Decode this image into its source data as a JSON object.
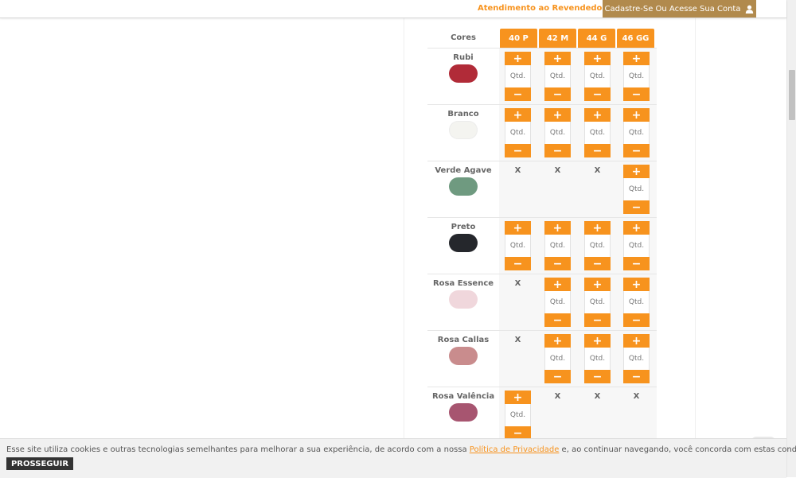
{
  "topbar": {
    "reseller_link": "Atendimento ao Revendedor",
    "account_button": "Cadastre-Se Ou Acesse Sua Conta"
  },
  "grid": {
    "colors_label": "Cores",
    "sizes": [
      "40 P",
      "42 M",
      "44 G",
      "46 GG"
    ],
    "plus_symbol": "+",
    "minus_symbol": "−",
    "qty_placeholder": "Qtd.",
    "unavailable_mark": "X",
    "rows": [
      {
        "name": "Rubi",
        "swatch": "#b12b38",
        "available": [
          true,
          true,
          true,
          true
        ]
      },
      {
        "name": "Branco",
        "swatch": "#f4f4f0",
        "available": [
          true,
          true,
          true,
          true
        ]
      },
      {
        "name": "Verde Agave",
        "swatch": "#6f9a80",
        "available": [
          false,
          false,
          false,
          true
        ]
      },
      {
        "name": "Preto",
        "swatch": "#25272c",
        "available": [
          true,
          true,
          true,
          true
        ]
      },
      {
        "name": "Rosa Essence",
        "swatch": "#f0d7dc",
        "available": [
          false,
          true,
          true,
          true
        ]
      },
      {
        "name": "Rosa Callas",
        "swatch": "#c98c8d",
        "available": [
          false,
          true,
          true,
          true
        ]
      },
      {
        "name": "Rosa Valência",
        "swatch": "#a75570",
        "available": [
          true,
          false,
          false,
          false
        ]
      }
    ]
  },
  "cookie": {
    "text_before": "Esse site utiliza cookies e outras tecnologias semelhantes para melhorar a sua experiência, de acordo com a nossa ",
    "link": "Política de Privacidade",
    "text_after": " e, ao continuar navegando, você concorda com estas condições.",
    "button": "PROSSEGUIR"
  },
  "colors": {
    "accent": "#f7931e",
    "account_bg": "#b18a4d",
    "button_dark": "#333333"
  },
  "icons": {
    "account": "user-icon"
  }
}
